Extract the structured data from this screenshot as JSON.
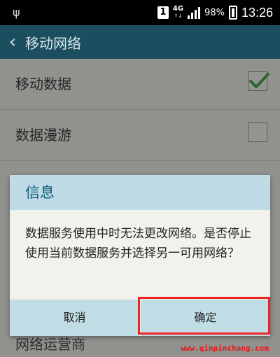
{
  "status_bar": {
    "usb_icon": "usb-icon",
    "sim": "1",
    "network": "4G",
    "network_sub": "↑↓",
    "battery": "98%",
    "time": "13:26"
  },
  "app_bar": {
    "title": "移动网络",
    "back_icon": "back-arrow-icon"
  },
  "settings": [
    {
      "label": "移动数据",
      "checked": true
    },
    {
      "label": "数据漫游",
      "checked": false
    }
  ],
  "dialog": {
    "title": "信息",
    "message": "数据服务使用中时无法更改网络。是否停止使用当前数据服务并选择另一可用网络？",
    "cancel_label": "取消",
    "ok_label": "确定"
  },
  "partial_row": "网络运营商",
  "watermark": "www.qinpinchang.com",
  "colors": {
    "app_bar": "#1b4e5e",
    "dialog_title_bg": "#bfdce6",
    "highlight": "#e22222"
  }
}
